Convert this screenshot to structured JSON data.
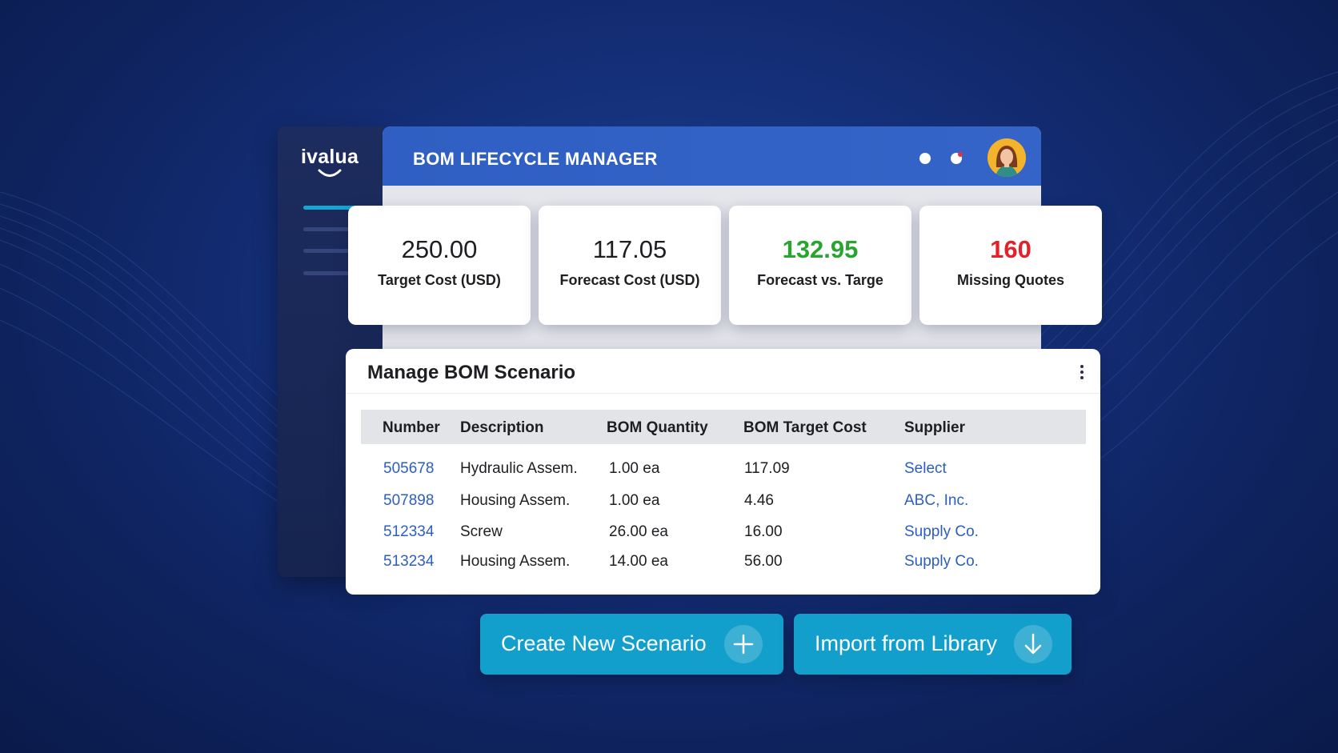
{
  "brand": {
    "logo_text": "ivalua"
  },
  "header": {
    "title": "BOM LIFECYCLE MANAGER"
  },
  "kpis": [
    {
      "value": "250.00",
      "label": "Target Cost (USD)"
    },
    {
      "value": "117.05",
      "label": "Forecast Cost (USD)"
    },
    {
      "value": "132.95",
      "label": "Forecast vs. Targe"
    },
    {
      "value": "160",
      "label": "Missing Quotes"
    }
  ],
  "scenario": {
    "title": "Manage BOM Scenario",
    "columns": [
      "Number",
      "Description",
      "BOM Quantity",
      "BOM Target Cost",
      "Supplier"
    ],
    "rows": [
      {
        "number": "505678",
        "description": "Hydraulic Assem.",
        "quantity": "1.00 ea",
        "target_cost": "117.09",
        "supplier": "Select"
      },
      {
        "number": "507898",
        "description": "Housing Assem.",
        "quantity": "1.00 ea",
        "target_cost": "4.46",
        "supplier": "ABC, Inc."
      },
      {
        "number": "512334",
        "description": "Screw",
        "quantity": "26.00 ea",
        "target_cost": "16.00",
        "supplier": "Supply Co."
      },
      {
        "number": "513234",
        "description": "Housing Assem.",
        "quantity": "14.00 ea",
        "target_cost": "56.00",
        "supplier": "Supply Co."
      }
    ]
  },
  "actions": {
    "create_label": "Create New Scenario",
    "create_icon": "plus-icon",
    "import_label": "Import from Library",
    "import_icon": "arrow-down-icon"
  },
  "colors": {
    "header_blue": "#3564c8",
    "accent_cyan": "#139fcb",
    "positive_green": "#27a52f",
    "alert_red": "#e4202a",
    "link_blue": "#2c5ec1"
  }
}
